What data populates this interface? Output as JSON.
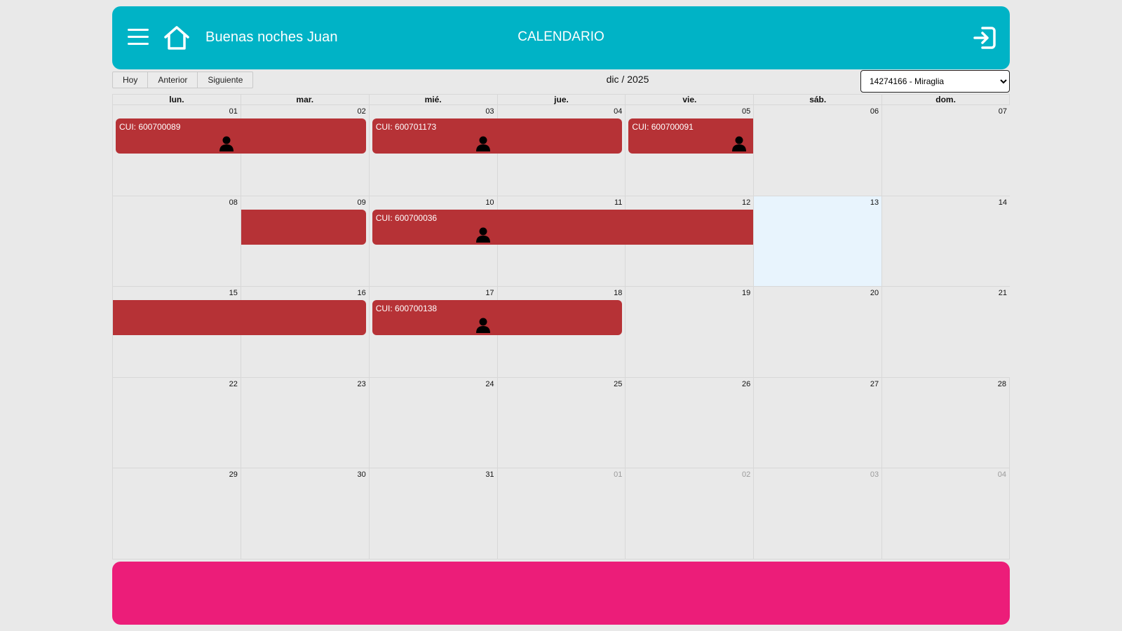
{
  "header": {
    "menu_icon": "hamburger-menu-icon",
    "home_icon": "home-icon",
    "greeting": "Buenas noches Juan",
    "title": "CALENDARIO",
    "logout_icon": "logout-icon",
    "bg_color": "#00b3c6"
  },
  "toolbar": {
    "today_label": "Hoy",
    "prev_label": "Anterior",
    "next_label": "Siguiente",
    "month_label": "dic / 2025"
  },
  "member_select": {
    "selected": "14274166 - Miraglia"
  },
  "calendar": {
    "weekdays": [
      "lun.",
      "mar.",
      "mié.",
      "jue.",
      "vie.",
      "sáb.",
      "dom."
    ],
    "weeks": [
      [
        "01",
        "02",
        "03",
        "04",
        "05",
        "06",
        "07"
      ],
      [
        "08",
        "09",
        "10",
        "11",
        "12",
        "13",
        "14"
      ],
      [
        "15",
        "16",
        "17",
        "18",
        "19",
        "20",
        "21"
      ],
      [
        "22",
        "23",
        "24",
        "25",
        "26",
        "27",
        "28"
      ],
      [
        "29",
        "30",
        "31",
        "01",
        "02",
        "03",
        "04"
      ]
    ],
    "today": "13",
    "event_color": "#b63236",
    "events": [
      {
        "label": "CUI: 600700089",
        "start": "01",
        "end": "02"
      },
      {
        "label": "CUI: 600701173",
        "start": "03",
        "end": "04"
      },
      {
        "label": "CUI: 600700091",
        "start": "05",
        "end": "05"
      },
      {
        "label": "",
        "start": "09",
        "end": "09"
      },
      {
        "label": "CUI: 600700036",
        "start": "10",
        "end": "12"
      },
      {
        "label": "",
        "start": "15",
        "end": "16"
      },
      {
        "label": "CUI: 600700138",
        "start": "17",
        "end": "18"
      }
    ],
    "event_icon": "user-icon"
  },
  "footer": {
    "bg_color": "#ec1d79"
  }
}
